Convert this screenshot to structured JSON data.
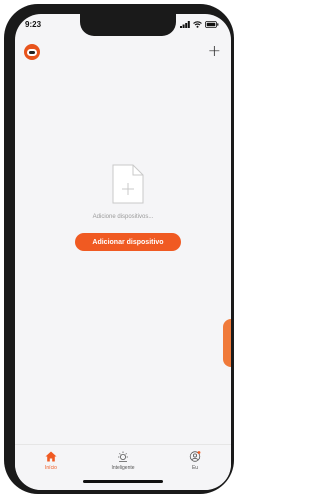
{
  "status": {
    "time": "9:23"
  },
  "header": {
    "logo_icon": "tuya-robot-logo-icon",
    "add_icon": "+"
  },
  "empty_state": {
    "text": "Adicione dispositivos...",
    "button_label": "Adicionar dispositivo"
  },
  "tabs": [
    {
      "label": "Início",
      "icon": "home-icon",
      "active": true
    },
    {
      "label": "Inteligente",
      "icon": "sun-icon",
      "active": false
    },
    {
      "label": "Eu",
      "icon": "user-icon",
      "active": false
    }
  ],
  "colors": {
    "accent": "#f05a22",
    "background": "#f5f5f7"
  }
}
